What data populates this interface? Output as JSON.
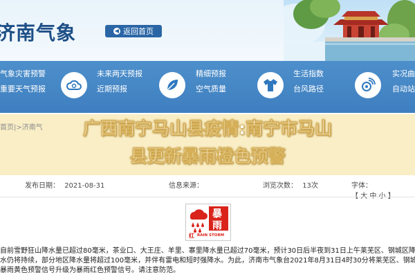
{
  "header": {
    "site_title": "济南气象",
    "back_home": "返回首页"
  },
  "nav": {
    "items": [
      {
        "line1": "气象灾害预警",
        "line2": "重要天气预报"
      },
      {
        "line1": "未来两天预报",
        "line2": "近期预报"
      },
      {
        "line1": "精细预报",
        "line2": "空气质量"
      },
      {
        "line1": "生活指数",
        "line2": "台风路径"
      },
      {
        "line1": "实况曲",
        "line2": "自动站"
      }
    ],
    "icons": [
      "cloud-icon",
      "leaf-icon",
      "shirt-icon",
      "satellite-icon"
    ]
  },
  "overlay": {
    "breadcrumb": "首页|>济南气",
    "headline_line1": "广西南宁马山县疫情:南宁市马山",
    "headline_line2": "县更新暴雨橙色预警"
  },
  "meta": {
    "publish_label": "发布日期：",
    "publish_date": "2021-08-31",
    "source_label": "信息来源：",
    "views_label": "浏览次数：",
    "views_value": "13次",
    "font_label": "字体：",
    "font_options": "【 大 中 小 】"
  },
  "warning_icon": {
    "zh_top": "暴",
    "zh_bottom": "雨",
    "color_label": "红",
    "en_label": "RAIN STORM",
    "color": "#d9231b"
  },
  "article": {
    "line1": "自前雪野狂山降水量已超过80毫米，茶业口、大王庄、羊里、寨里降水量已超过70毫米，预计30日后半夜到31日上午莱芜区、钢城区降",
    "line2": "水仍将持续，部分地区降水量将超过100毫米，并伴有雷电和短时强降水。为此，济南市气象台2021年8月31日4时30分将莱芜区、钢城区",
    "line3": "暴雨黄色预警信号升级为暴雨红色预警信号。请注意防范。"
  }
}
